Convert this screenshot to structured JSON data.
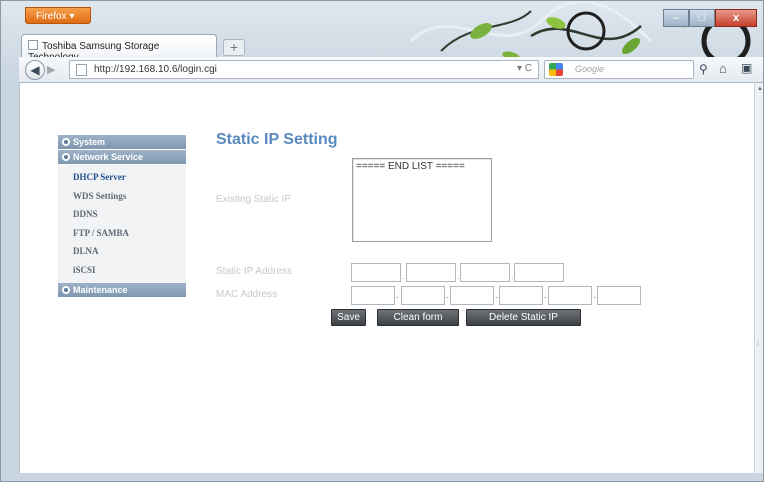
{
  "browser": {
    "menu_label": "Firefox",
    "tab_title": "Toshiba Samsung Storage Technology",
    "new_tab_label": "+",
    "url": "http://192.168.10.6/login.cgi",
    "search_placeholder": "Google",
    "window_controls": {
      "minimize": "–",
      "maximize": "□",
      "close": "x"
    },
    "icons": [
      "back-arrow-icon",
      "forward-arrow-icon",
      "page-icon",
      "reload-icon",
      "google-icon",
      "search-icon",
      "home-icon",
      "bookmarks-icon"
    ]
  },
  "sidebar": {
    "sections": [
      {
        "label": "System",
        "items": []
      },
      {
        "label": "Network Service",
        "items": [
          "DHCP Server",
          "WDS Settings",
          "DDNS",
          "FTP / SAMBA",
          "DLNA",
          "iSCSI"
        ],
        "active_item": "DHCP Server"
      },
      {
        "label": "Maintenance",
        "items": []
      }
    ]
  },
  "main": {
    "title": "Static IP Setting",
    "existing_label": "Existing Static IP",
    "list_items": [
      "===== END LIST ====="
    ],
    "ip_label": "Static IP Address",
    "ip_values": [
      "",
      "",
      "",
      ""
    ],
    "mac_label": "MAC Address",
    "mac_values": [
      "",
      "",
      "",
      "",
      "",
      ""
    ],
    "buttons": {
      "save": "Save",
      "clean": "Clean form",
      "delete": "Delete Static IP"
    }
  },
  "colors": {
    "title": "#5a89bf",
    "sidebar_header": "#8ea5bd",
    "active_item": "#1f4f8f",
    "button": "#4a4e52"
  }
}
